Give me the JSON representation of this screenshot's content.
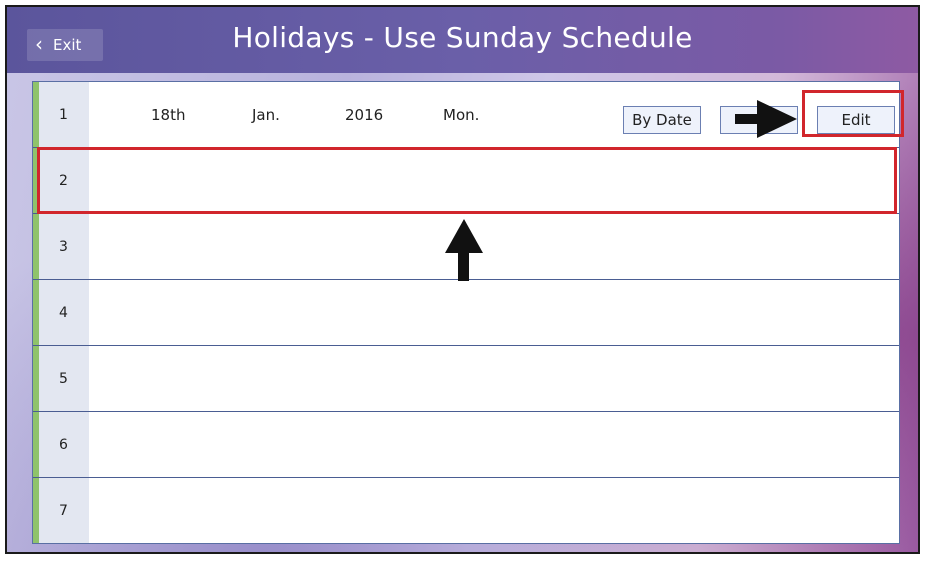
{
  "header": {
    "exit_label": "Exit",
    "title": "Holidays - Use Sunday Schedule"
  },
  "rows": [
    {
      "num": "1",
      "day": "18th",
      "month": "Jan.",
      "year": "2016",
      "weekday": "Mon.",
      "mode_label": "By Date",
      "edit_label": "Edit"
    },
    {
      "num": "2"
    },
    {
      "num": "3"
    },
    {
      "num": "4"
    },
    {
      "num": "5"
    },
    {
      "num": "6"
    },
    {
      "num": "7"
    }
  ],
  "colors": {
    "highlight": "#d1262c",
    "accent": "#8fc36b",
    "title_bar": "#6a5fa8"
  }
}
